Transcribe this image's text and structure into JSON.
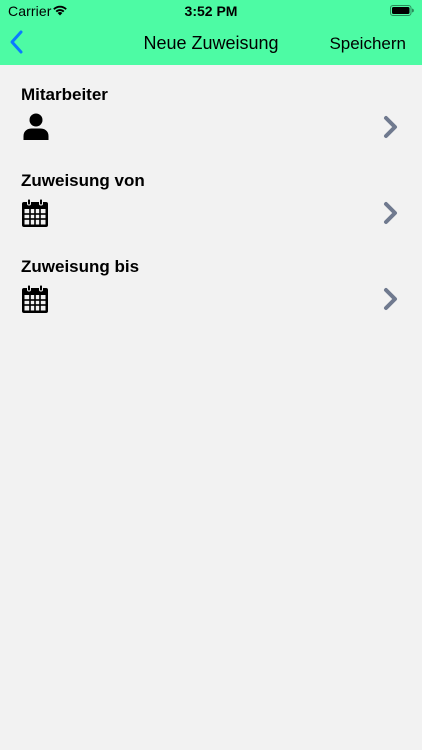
{
  "status_bar": {
    "carrier": "Carrier",
    "time": "3:52 PM",
    "wifi_icon": "wifi-icon",
    "battery_icon": "battery-full-icon"
  },
  "nav": {
    "back_icon": "chevron-left-icon",
    "title": "Neue Zuweisung",
    "save_label": "Speichern",
    "background": "#4dfba4",
    "back_color": "#0a7aff"
  },
  "rows": [
    {
      "label": "Mitarbeiter",
      "icon": "person-icon",
      "chevron_icon": "chevron-right-icon"
    },
    {
      "label": "Zuweisung von",
      "icon": "calendar-icon",
      "chevron_icon": "chevron-right-icon"
    },
    {
      "label": "Zuweisung bis",
      "icon": "calendar-icon",
      "chevron_icon": "chevron-right-icon"
    }
  ],
  "colors": {
    "background": "#f2f2f2",
    "chevron": "#707a8f"
  }
}
